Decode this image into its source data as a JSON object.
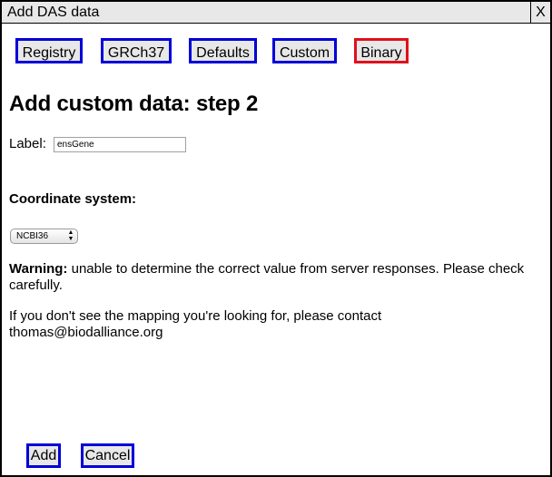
{
  "window": {
    "title": "Add DAS data",
    "close_label": "X"
  },
  "tabs": [
    {
      "label": "Registry",
      "active": false
    },
    {
      "label": "GRCh37",
      "active": false
    },
    {
      "label": "Defaults",
      "active": false
    },
    {
      "label": "Custom",
      "active": false
    },
    {
      "label": "Binary",
      "active": true
    }
  ],
  "main": {
    "heading": "Add custom data: step 2",
    "label_field": {
      "label": "Label:",
      "value": "ensGene"
    },
    "coordinate_heading": "Coordinate system:",
    "coordinate_select": {
      "selected": "NCBI36"
    },
    "warning_prefix": "Warning:",
    "warning_text": " unable to determine the correct value from server responses. Please check carefully.",
    "contact_text": "If you don't see the mapping you're looking for, please contact thomas@biodalliance.org"
  },
  "footer": {
    "add_label": "Add",
    "cancel_label": "Cancel"
  },
  "colors": {
    "tab_border": "#0000d8",
    "active_tab_border": "#e0101c"
  }
}
